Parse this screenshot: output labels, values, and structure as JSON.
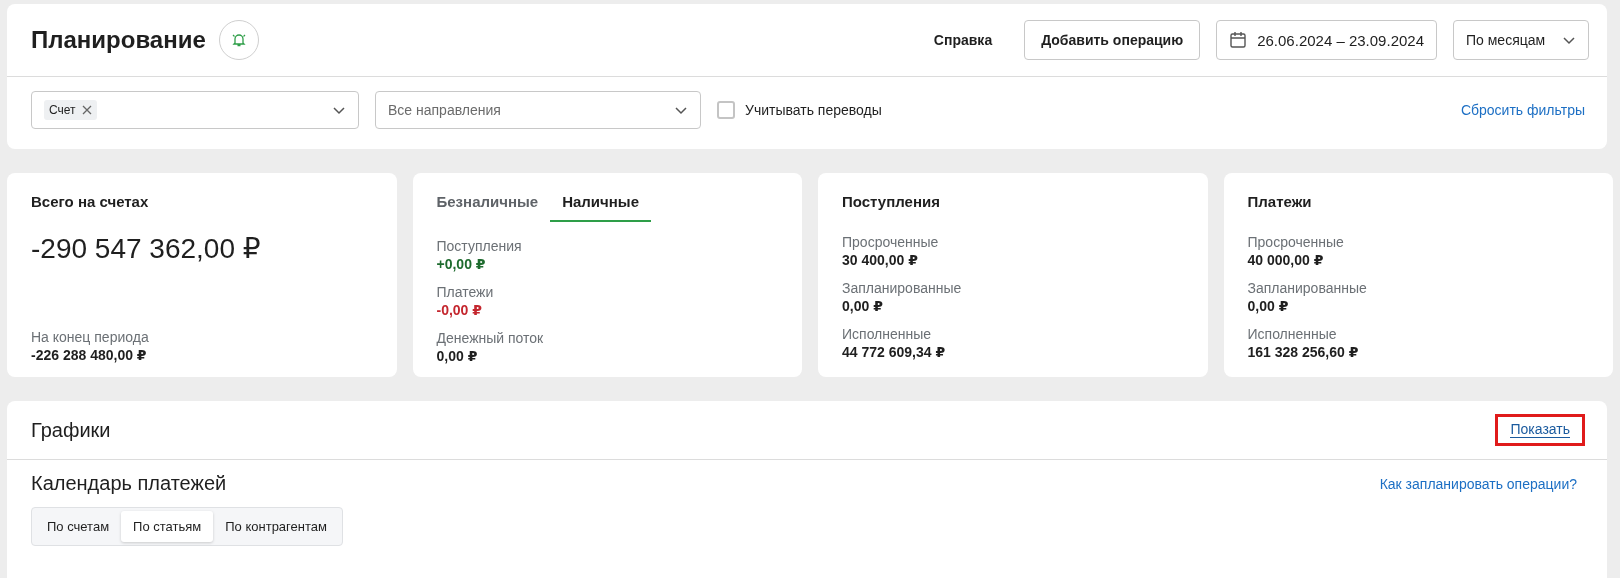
{
  "header": {
    "title": "Планирование",
    "help_link": "Справка",
    "add_button": "Добавить операцию",
    "date_range": "26.06.2024 – 23.09.2024",
    "period_select": "По месяцам"
  },
  "filters": {
    "account_select": {
      "chips": [
        {
          "label": "Счет"
        }
      ]
    },
    "direction_select": {
      "placeholder": "Все направления"
    },
    "transfers": {
      "label": "Учитывать переводы",
      "checked": false
    },
    "reset_link": "Сбросить фильтры"
  },
  "cards": [
    {
      "kind": "total",
      "title": "Всего на счетах",
      "amount": "-290 547 362,00 ₽",
      "footer_label": "На конец периода",
      "footer_value": "-226 288 480,00 ₽"
    },
    {
      "kind": "tabs",
      "tabs": [
        {
          "label": "Безналичные",
          "selected": false
        },
        {
          "label": "Наличные",
          "selected": true
        }
      ],
      "rows": [
        {
          "label": "Поступления",
          "value": "+0,00 ₽",
          "color": "#1e6b2e"
        },
        {
          "label": "Платежи",
          "value": "-0,00 ₽",
          "color": "#c4262e"
        },
        {
          "label": "Денежный поток",
          "value": "0,00 ₽",
          "color": "#1f1f1f"
        }
      ]
    },
    {
      "kind": "stats",
      "title": "Поступления",
      "rows": [
        {
          "label": "Просроченные",
          "value": "30 400,00 ₽"
        },
        {
          "label": "Запланированные",
          "value": "0,00 ₽"
        },
        {
          "label": "Исполненные",
          "value": "44 772 609,34 ₽"
        }
      ]
    },
    {
      "kind": "stats",
      "title": "Платежи",
      "rows": [
        {
          "label": "Просроченные",
          "value": "40 000,00 ₽"
        },
        {
          "label": "Запланированные",
          "value": "0,00 ₽"
        },
        {
          "label": "Исполненные",
          "value": "161 328 256,60 ₽"
        }
      ]
    }
  ],
  "charts": {
    "title": "Графики",
    "toggle_link": {
      "label": "Показать",
      "highlighted": true
    },
    "calendar_title": "Календарь платежей",
    "help_link": "Как запланировать операции?",
    "segments": [
      {
        "label": "По счетам",
        "selected": false
      },
      {
        "label": "По статьям",
        "selected": true
      },
      {
        "label": "По контрагентам",
        "selected": false
      }
    ]
  }
}
